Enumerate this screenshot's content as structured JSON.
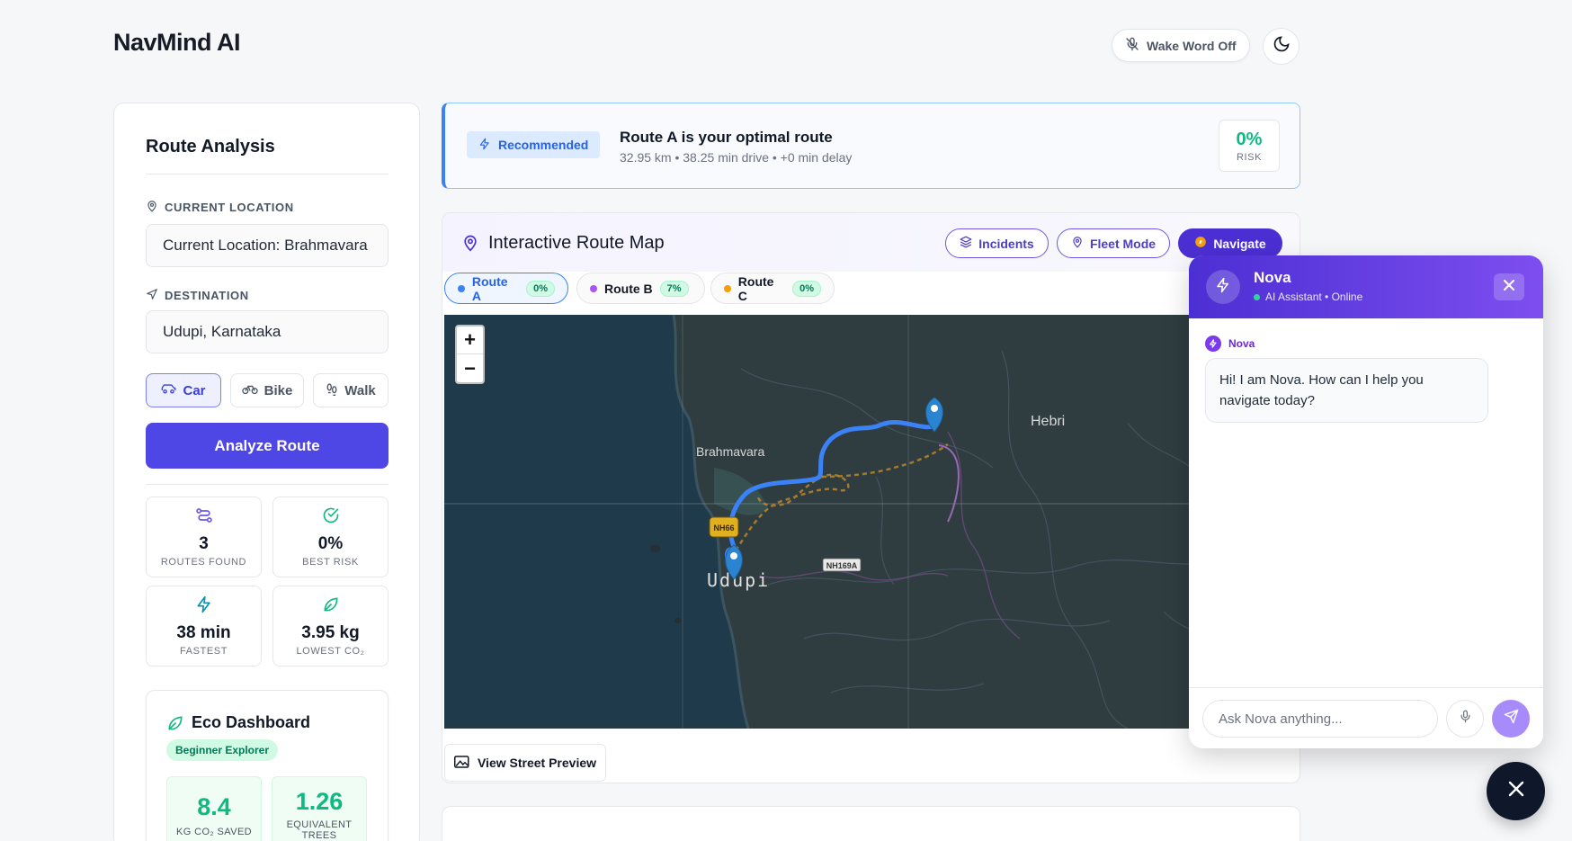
{
  "header": {
    "brand": "NavMind AI",
    "wake_word_label": "Wake Word Off"
  },
  "sidebar": {
    "title": "Route Analysis",
    "current_location_label": "CURRENT LOCATION",
    "current_location_value": "Current Location: Brahmavara",
    "destination_label": "DESTINATION",
    "destination_value": "Udupi, Karnataka",
    "modes": [
      {
        "label": "Car",
        "active": true
      },
      {
        "label": "Bike",
        "active": false
      },
      {
        "label": "Walk",
        "active": false
      }
    ],
    "analyze_label": "Analyze Route",
    "stats": [
      {
        "value": "3",
        "label": "ROUTES FOUND",
        "icon": "routes-icon"
      },
      {
        "value": "0%",
        "label": "BEST RISK",
        "icon": "check-circle-icon"
      },
      {
        "value": "38 min",
        "label": "FASTEST",
        "icon": "lightning-icon"
      },
      {
        "value": "3.95 kg",
        "label": "LOWEST CO₂",
        "icon": "leaf-icon"
      }
    ],
    "eco": {
      "title": "Eco Dashboard",
      "badge": "Beginner Explorer",
      "cards": [
        {
          "value": "8.4",
          "label": "KG CO₂ SAVED"
        },
        {
          "value": "1.26",
          "label": "EQUIVALENT TREES"
        }
      ]
    }
  },
  "recommendation": {
    "badge": "Recommended",
    "title": "Route A is your optimal route",
    "subtitle": "32.95 km • 38.25 min drive • +0 min delay",
    "risk_value": "0%",
    "risk_label": "RISK"
  },
  "map_panel": {
    "title": "Interactive Route Map",
    "buttons": {
      "incidents": "Incidents",
      "fleet": "Fleet Mode",
      "navigate": "Navigate"
    },
    "routes": [
      {
        "label": "Route A",
        "pct": "0%",
        "color": "#3b82f6",
        "active": true
      },
      {
        "label": "Route B",
        "pct": "7%",
        "color": "#a855f7",
        "active": false
      },
      {
        "label": "Route C",
        "pct": "0%",
        "color": "#f59e0b",
        "active": false
      }
    ],
    "map_labels": {
      "brahmavara": "Brahmavara",
      "hebri": "Hebri",
      "udupi": "Udupi",
      "nh66": "NH66",
      "nh169a": "NH169A"
    },
    "zoom_in": "+",
    "zoom_out": "−",
    "street_preview": "View Street Preview"
  },
  "chat": {
    "name": "Nova",
    "status": "AI Assistant • Online",
    "sender": "Nova",
    "message": "Hi! I am Nova. How can I help you navigate today?",
    "placeholder": "Ask Nova anything..."
  },
  "colors": {
    "primary": "#4e46e5",
    "eco_green": "#10b981",
    "route_a": "#3b82f6",
    "route_b": "#a855f7",
    "route_c": "#f59e0b"
  }
}
